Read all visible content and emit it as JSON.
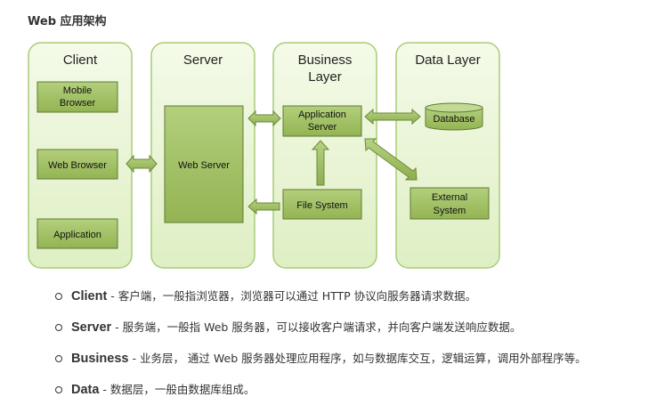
{
  "page": {
    "heading": "Web 应用架构"
  },
  "diagram": {
    "columns": [
      {
        "key": "client",
        "title": "Client"
      },
      {
        "key": "server",
        "title": "Server"
      },
      {
        "key": "business",
        "title_line1": "Business",
        "title_line2": "Layer"
      },
      {
        "key": "data",
        "title": "Data Layer"
      }
    ],
    "boxes": {
      "mobile_browser": {
        "line1": "Mobile",
        "line2": "Browser"
      },
      "web_browser": "Web Browser",
      "application": "Application",
      "web_server": "Web Server",
      "application_server": {
        "line1": "Application",
        "line2": "Server"
      },
      "file_system": "File System",
      "database": "Database",
      "external_system": {
        "line1": "External",
        "line2": "System"
      }
    },
    "colors": {
      "panel_fill": "#e8f5d0",
      "panel_border": "#a8cc78",
      "box_fill": "#9bbb59",
      "box_border": "#5f7a33",
      "arrow_fill": "#9bbb59",
      "arrow_border": "#6a8a3a"
    }
  },
  "bullets": [
    {
      "term": "Client",
      "sep": " - ",
      "desc": "客户端，一般指浏览器，浏览器可以通过 HTTP 协议向服务器请求数据。"
    },
    {
      "term": "Server",
      "sep": " - ",
      "desc": "服务端，一般指 Web 服务器，可以接收客户端请求，并向客户端发送响应数据。"
    },
    {
      "term": "Business",
      "sep": " - ",
      "desc": "业务层， 通过 Web 服务器处理应用程序，如与数据库交互，逻辑运算，调用外部程序等。"
    },
    {
      "term": "Data",
      "sep": " - ",
      "desc": "数据层，一般由数据库组成。"
    }
  ]
}
